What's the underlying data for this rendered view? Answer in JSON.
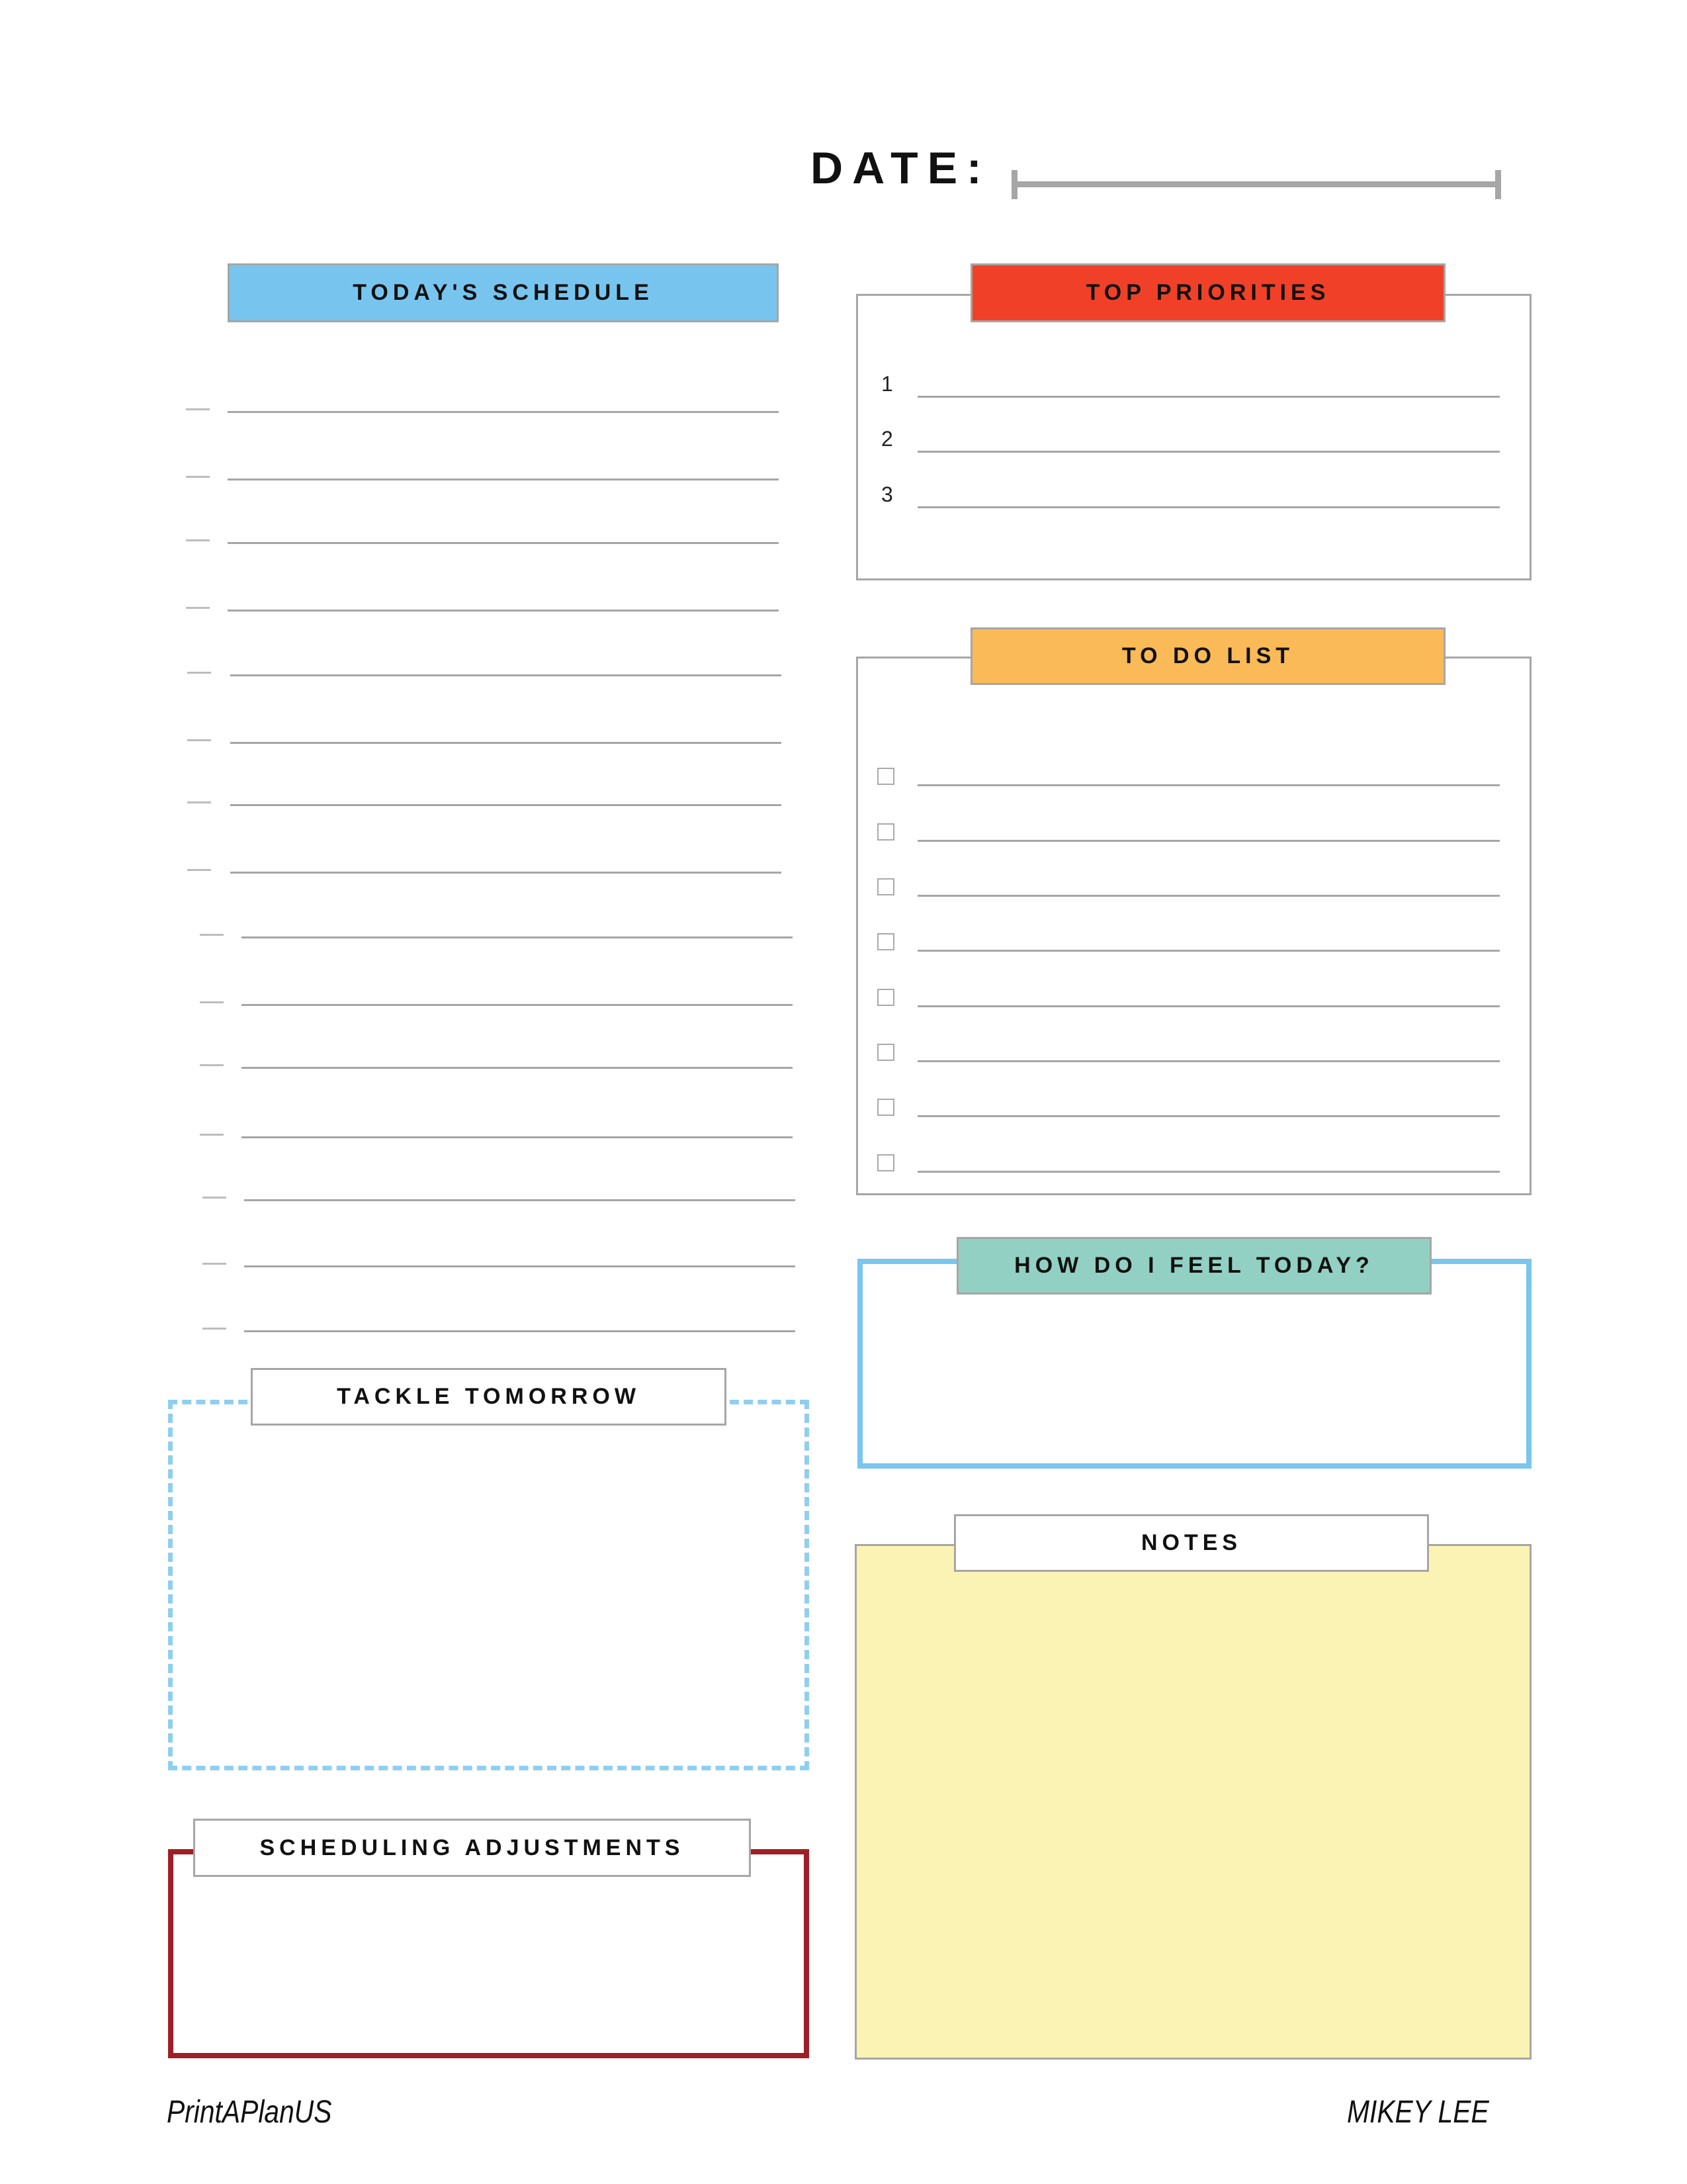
{
  "date": {
    "label": "DATE:"
  },
  "schedule": {
    "title": "TODAY'S SCHEDULE",
    "line_count": 15
  },
  "priorities": {
    "title": "TOP PRIORITIES",
    "items": [
      "1",
      "2",
      "3"
    ]
  },
  "todo": {
    "title": "TO DO LIST",
    "item_count": 8
  },
  "feel": {
    "title": "HOW DO I FEEL TODAY?"
  },
  "notes": {
    "title": "NOTES"
  },
  "tackle": {
    "title": "TACKLE TOMORROW"
  },
  "adjustments": {
    "title": "SCHEDULING ADJUSTMENTS"
  },
  "footer": {
    "brand": "PrintAPlanUS",
    "author": "MIKEY LEE"
  },
  "colors": {
    "schedule": "#77C5EF",
    "priorities": "#F04128",
    "todo": "#FBBA58",
    "feel_header": "#93D0C4",
    "feel_border": "#79C6EE",
    "notes_fill": "#FBF3B3",
    "tackle_border": "#8ECFF0",
    "adjust_border": "#A01F26"
  }
}
